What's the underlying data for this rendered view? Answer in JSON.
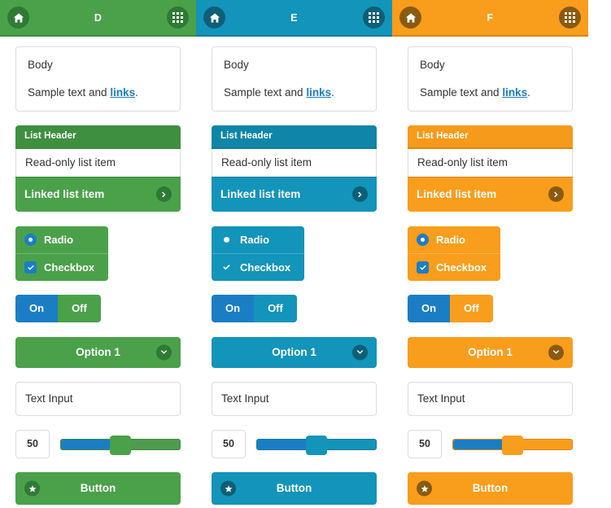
{
  "page": {
    "background": "#ffffff",
    "accent_blue": "#1b7ec4",
    "link_color": "#1b7ec4"
  },
  "columns": [
    {
      "id": "swatch-d",
      "theme_name": "green",
      "colors": {
        "bar": "#4aa14a",
        "bar_border": "#3d8b3d",
        "dark": "#2f7a34",
        "circle": "#2f7a34",
        "list_header": "#3f8f40",
        "body": "#4aa14a",
        "track": "#4e9a4e"
      },
      "header": {
        "title": "D",
        "home_icon": "home-icon",
        "grid_icon": "grid-icon"
      },
      "card": {
        "title": "Body",
        "text_before": "Sample text and ",
        "link": "links",
        "text_after": "."
      },
      "list": {
        "header": "List Header",
        "readonly_item": "Read-only list item",
        "linked_item": "Linked list item",
        "chevron_icon": "chevron-right-icon"
      },
      "choices": {
        "radio_label": "Radio",
        "checkbox_label": "Checkbox",
        "radio_icon": "radio-selected-icon",
        "checkbox_icon": "checkbox-checked-icon"
      },
      "toggle": {
        "on_label": "On",
        "off_label": "Off",
        "active": "On"
      },
      "select": {
        "value": "Option 1",
        "chevron_icon": "chevron-down-icon"
      },
      "text_input": {
        "value": "Text Input",
        "placeholder": "Text Input"
      },
      "slider": {
        "value": "50",
        "percent": 50
      },
      "button": {
        "label": "Button",
        "icon": "star-icon"
      }
    },
    {
      "id": "swatch-e",
      "theme_name": "blue",
      "colors": {
        "bar": "#1394ba",
        "bar_border": "#107d9e",
        "dark": "#0d6f8c",
        "circle": "#0d5f77",
        "list_header": "#0f86a8",
        "body": "#1394ba",
        "track": "#1394ba"
      },
      "header": {
        "title": "E",
        "home_icon": "home-icon",
        "grid_icon": "grid-icon"
      },
      "card": {
        "title": "Body",
        "text_before": "Sample text and ",
        "link": "links",
        "text_after": "."
      },
      "list": {
        "header": "List Header",
        "readonly_item": "Read-only list item",
        "linked_item": "Linked list item",
        "chevron_icon": "chevron-right-icon"
      },
      "choices": {
        "radio_label": "Radio",
        "checkbox_label": "Checkbox",
        "radio_icon": "radio-selected-icon",
        "checkbox_icon": "checkbox-checked-icon"
      },
      "toggle": {
        "on_label": "On",
        "off_label": "Off",
        "active": "On"
      },
      "select": {
        "value": "Option 1",
        "chevron_icon": "chevron-down-icon"
      },
      "text_input": {
        "value": "Text Input",
        "placeholder": "Text Input"
      },
      "slider": {
        "value": "50",
        "percent": 50
      },
      "button": {
        "label": "Button",
        "icon": "star-icon"
      }
    },
    {
      "id": "swatch-f",
      "theme_name": "orange",
      "colors": {
        "bar": "#f99d1c",
        "bar_border": "#d98713",
        "dark": "#8a5a10",
        "circle": "#8a5a10",
        "list_header": "#f59a1b",
        "body": "#f99d1c",
        "track": "#f99d1c"
      },
      "header": {
        "title": "F",
        "home_icon": "home-icon",
        "grid_icon": "grid-icon"
      },
      "card": {
        "title": "Body",
        "text_before": "Sample text and ",
        "link": "links",
        "text_after": "."
      },
      "list": {
        "header": "List Header",
        "readonly_item": "Read-only list item",
        "linked_item": "Linked list item",
        "chevron_icon": "chevron-right-icon"
      },
      "choices": {
        "radio_label": "Radio",
        "checkbox_label": "Checkbox",
        "radio_icon": "radio-selected-icon",
        "checkbox_icon": "checkbox-checked-icon"
      },
      "toggle": {
        "on_label": "On",
        "off_label": "Off",
        "active": "On"
      },
      "select": {
        "value": "Option 1",
        "chevron_icon": "chevron-down-icon"
      },
      "text_input": {
        "value": "Text Input",
        "placeholder": "Text Input"
      },
      "slider": {
        "value": "50",
        "percent": 50
      },
      "button": {
        "label": "Button",
        "icon": "star-icon"
      }
    }
  ]
}
